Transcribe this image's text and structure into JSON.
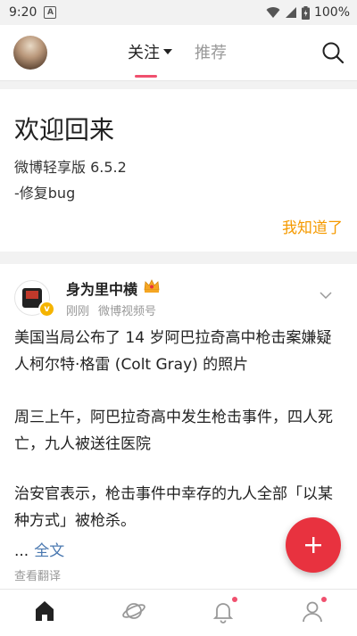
{
  "status_bar": {
    "time": "9:20",
    "notification_icon_letter": "A",
    "battery": "100%"
  },
  "header": {
    "tabs": [
      {
        "label": "关注",
        "selected": true
      },
      {
        "label": "推荐",
        "selected": false
      }
    ],
    "accent_color": "#f0506e"
  },
  "welcome_card": {
    "title": "欢迎回来",
    "version": "微博轻享版 6.5.2",
    "changelog": "-修复bug",
    "ack_button": "我知道了"
  },
  "post": {
    "author": "身为里中横",
    "time": "刚刚",
    "source": "微博视频号",
    "paragraphs": [
      "美国当局公布了 14 岁阿巴拉奇高中枪击案嫌疑人柯尔特·格雷 (Colt Gray) 的照片",
      "周三上午，阿巴拉奇高中发生枪击事件，四人死亡，九人被送往医院",
      "治安官表示，枪击事件中幸存的九人全部「以某种方式」被枪杀。"
    ],
    "ellipsis": "...",
    "full_text_link": "全文",
    "translate_link": "查看翻译"
  },
  "fab_color": "#e8323f",
  "bottom_nav": [
    {
      "icon": "home-icon",
      "active": true
    },
    {
      "icon": "discover-planet-icon",
      "active": false
    },
    {
      "icon": "bell-icon",
      "active": false,
      "has_dot": true
    },
    {
      "icon": "profile-icon",
      "active": false,
      "has_dot": true
    }
  ]
}
